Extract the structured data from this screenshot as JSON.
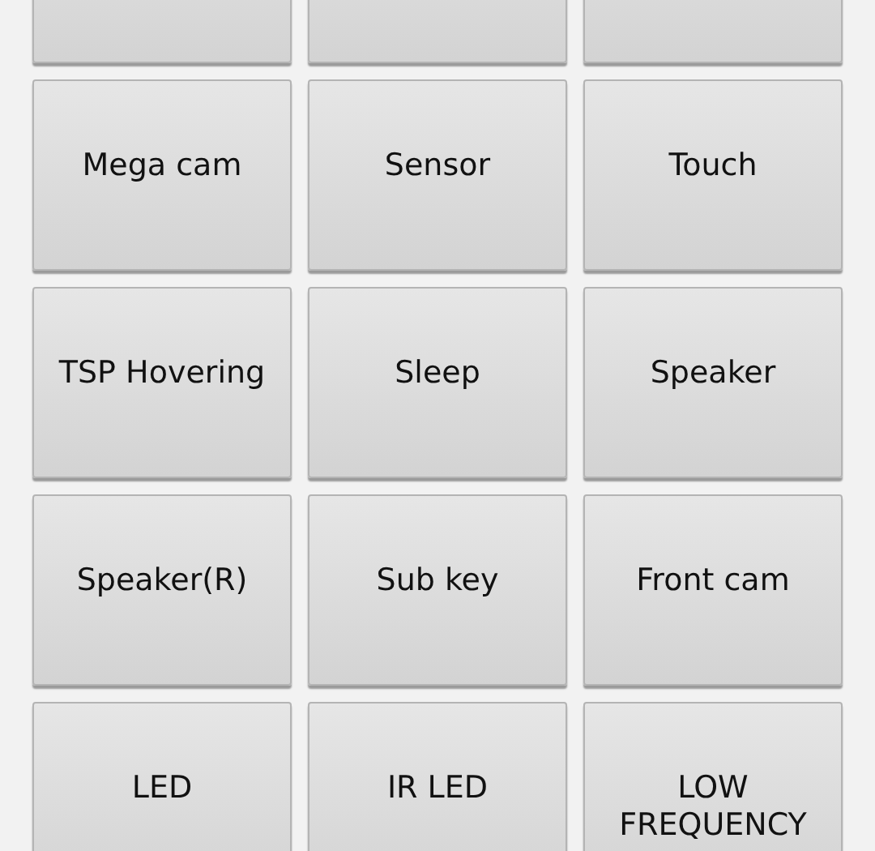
{
  "buttons": [
    {
      "kind": "cut"
    },
    {
      "kind": "cut"
    },
    {
      "kind": "cut"
    },
    {
      "kind": "label",
      "label": "Mega cam"
    },
    {
      "kind": "label",
      "label": "Sensor"
    },
    {
      "kind": "label",
      "label": "Touch"
    },
    {
      "kind": "label",
      "label": "TSP Hovering"
    },
    {
      "kind": "label",
      "label": "Sleep"
    },
    {
      "kind": "label",
      "label": "Speaker"
    },
    {
      "kind": "label",
      "label": "Speaker(R)"
    },
    {
      "kind": "label",
      "label": "Sub key"
    },
    {
      "kind": "label",
      "label": "Front cam"
    },
    {
      "kind": "label",
      "label": "LED"
    },
    {
      "kind": "label",
      "label": "IR LED"
    },
    {
      "kind": "label",
      "label": "LOW FREQUENCY"
    }
  ]
}
